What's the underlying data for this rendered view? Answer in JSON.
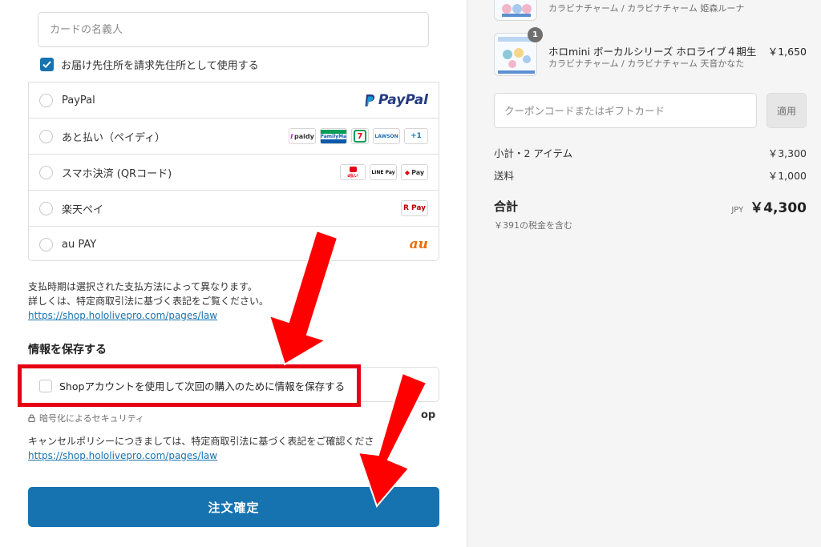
{
  "billing": {
    "card_name_placeholder": "カードの名義人",
    "use_shipping_as_billing": "お届け先住所を請求先住所として使用する"
  },
  "payment_methods": [
    {
      "label": "PayPal",
      "logos": [
        "PayPal"
      ]
    },
    {
      "label": "あと払い（ペイディ）",
      "logos": [
        "paidy",
        "FamilyMart",
        "7",
        "LAWSON",
        "+1"
      ]
    },
    {
      "label": "スマホ決済 (QRコード)",
      "logos": [
        "d払い",
        "LINE Pay",
        "Pay"
      ]
    },
    {
      "label": "楽天ペイ",
      "logos": [
        "R Pay"
      ]
    },
    {
      "label": "au PAY",
      "logos": [
        "au"
      ]
    }
  ],
  "payment_note": {
    "line1": "支払時期は選択された支払方法によって異なります。",
    "line2": "詳しくは、特定商取引法に基づく表記をご覧ください。",
    "link": "https://shop.hololivepro.com/pages/law"
  },
  "save_info": {
    "title": "情報を保存する",
    "checkbox_label": "Shopアカウントを使用して次回の購入のために情報を保存する",
    "partial_logo": "op"
  },
  "security_note": "暗号化によるセキュリティ",
  "cancel_note": {
    "text": "キャンセルポリシーにつきましては、特定商取引法に基づく表記をご確認くださ",
    "link": "https://shop.hololivepro.com/pages/law"
  },
  "submit_label": "注文確定",
  "cart": {
    "items": [
      {
        "title": "",
        "subtitle": "カラビナチャーム / カラビナチャーム 姫森ルーナ",
        "price": "",
        "qty": ""
      },
      {
        "title": "ホロmini ボーカルシリーズ ホロライブ４期生",
        "subtitle": "カラビナチャーム / カラビナチャーム 天音かなた",
        "price": "￥1,650",
        "qty": "1"
      }
    ],
    "coupon_placeholder": "クーポンコードまたはギフトカード",
    "apply_label": "適用",
    "subtotal_label": "小計・2 アイテム",
    "subtotal_value": "￥3,300",
    "shipping_label": "送料",
    "shipping_value": "￥1,000",
    "total_label": "合計",
    "total_currency": "JPY",
    "total_value": "￥4,300",
    "tax_note": "￥391の税金を含む"
  },
  "colors": {
    "primary": "#1773b0",
    "annotation_red": "#e60012"
  }
}
